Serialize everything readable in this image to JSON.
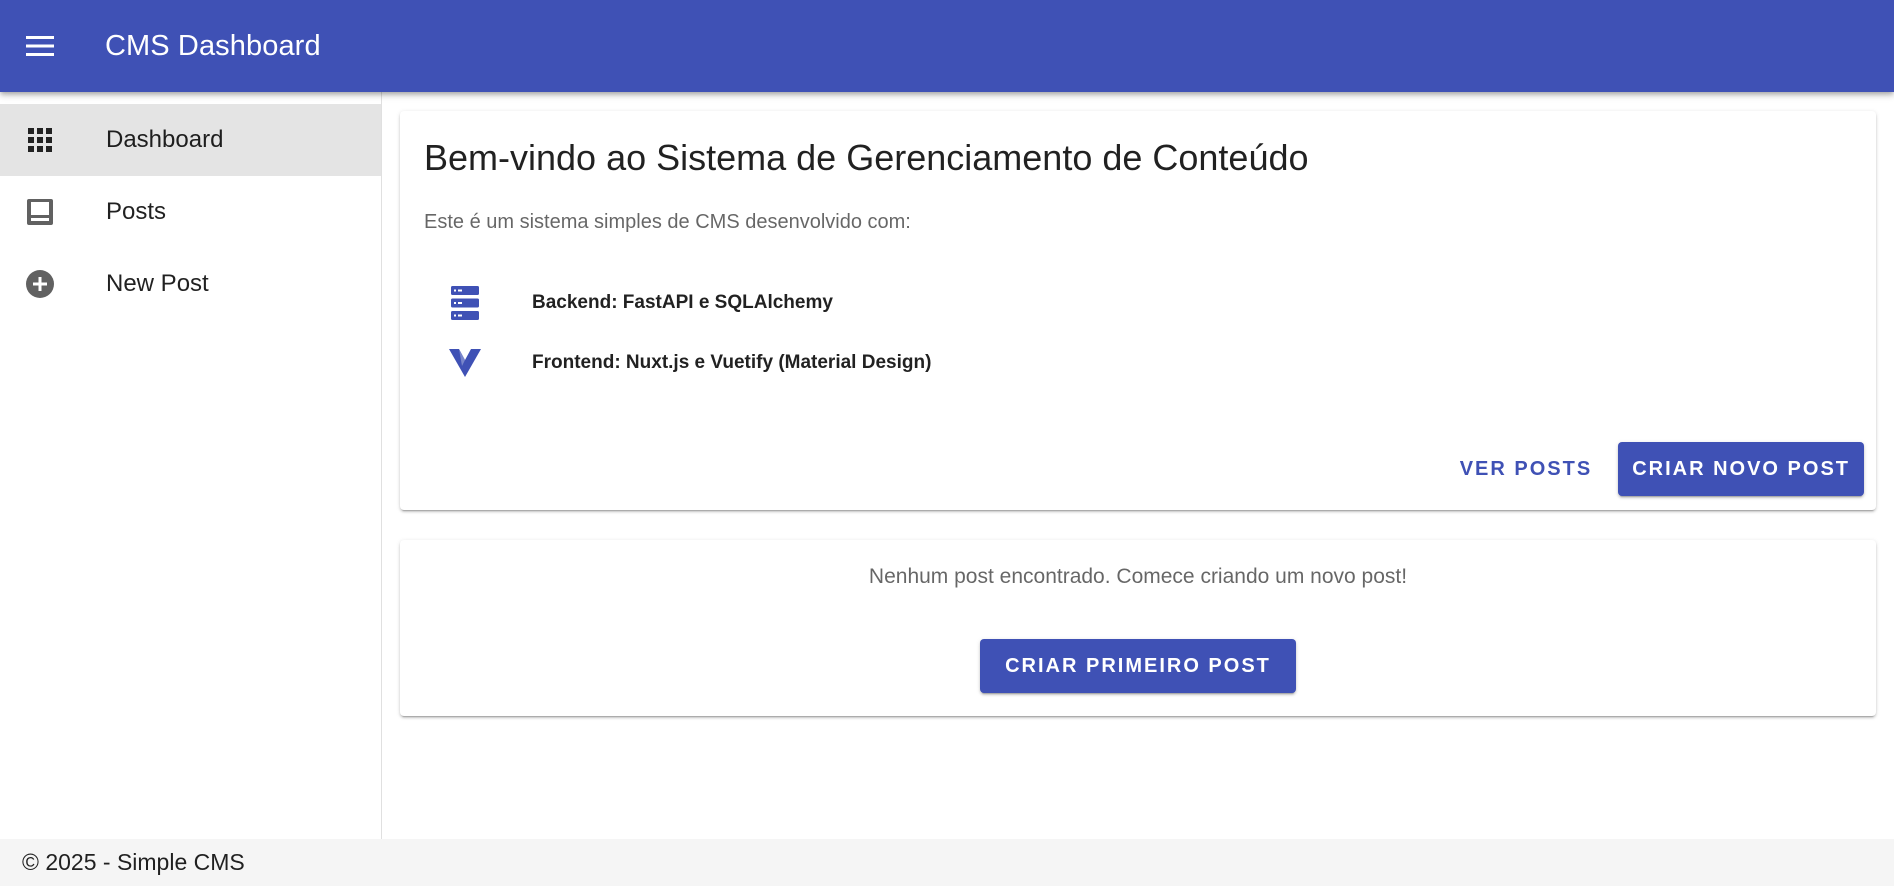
{
  "colors": {
    "primary": "#3f51b5",
    "nav_active_bg": "#e4e4e4",
    "footer_bg": "#f5f5f5",
    "icon_gray": "#616161"
  },
  "appbar": {
    "menu_icon": "hamburger-menu-icon",
    "title": "CMS Dashboard"
  },
  "sidebar": {
    "items": [
      {
        "label": "Dashboard",
        "icon": "apps-grid-icon",
        "active": true
      },
      {
        "label": "Posts",
        "icon": "view-agenda-icon",
        "active": false
      },
      {
        "label": "New Post",
        "icon": "plus-circle-icon",
        "active": false
      }
    ]
  },
  "welcome": {
    "title": "Bem-vindo ao Sistema de Gerenciamento de Conteúdo",
    "subtitle": "Este é um sistema simples de CMS desenvolvido com:",
    "tech": [
      {
        "label": "Backend: FastAPI e SQLAlchemy",
        "icon": "server-icon"
      },
      {
        "label": "Frontend: Nuxt.js e Vuetify (Material Design)",
        "icon": "vuetify-logo-icon"
      }
    ],
    "actions": {
      "view_posts": "Ver Posts",
      "create_post": "Criar Novo Post"
    }
  },
  "empty_state": {
    "message": "Nenhum post encontrado. Comece criando um novo post!",
    "button": "Criar Primeiro Post"
  },
  "footer": {
    "text": "© 2025 - Simple CMS"
  }
}
